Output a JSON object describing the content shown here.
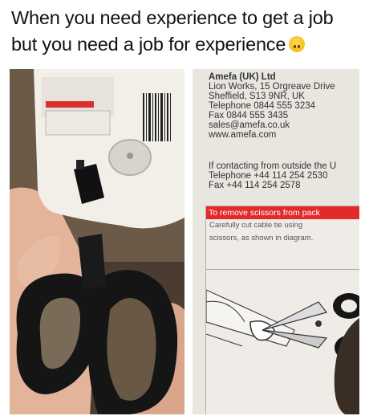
{
  "caption": {
    "line1": "When you need experience to get a job",
    "line2": "but you need a job for experience"
  },
  "emoji_icon": "upside-down-face-icon",
  "label": {
    "company": "Amefa (UK) Ltd",
    "address": [
      "Lion Works, 15 Orgreave Drive",
      "Sheffield, S13 9NR, UK"
    ],
    "telephone": "Telephone 0844 555 3234",
    "fax": "Fax 0844 555 3435",
    "email": "sales@amefa.co.uk",
    "website": "www.amefa.com",
    "outside_heading": "If contacting from outside the U",
    "outside_telephone": "Telephone +44 114 254 2530",
    "outside_fax": "Fax +44 114 254 2578"
  },
  "instructions": {
    "heading": "To remove scissors from pack",
    "line1": "Carefully cut cable tie using",
    "line2": "scissors, as shown in diagram."
  },
  "colors": {
    "instruction_red": "#e22a2a",
    "handle_black": "#151515"
  }
}
